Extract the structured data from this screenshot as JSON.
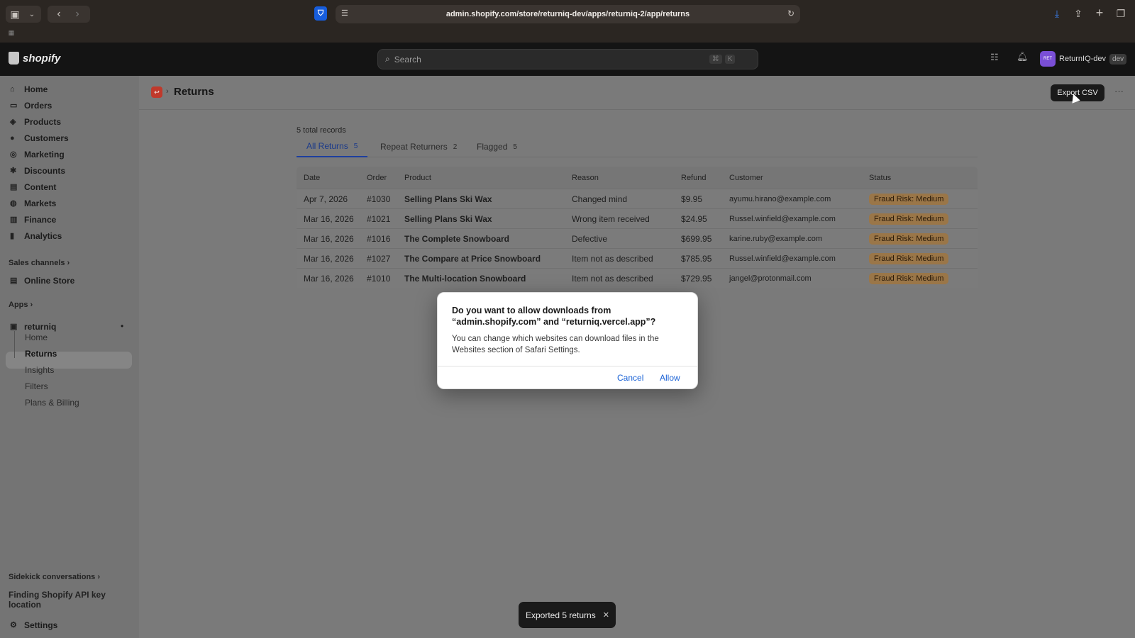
{
  "browser": {
    "url": "admin.shopify.com/store/returniq-dev/apps/returniq-2/app/returns"
  },
  "topbar": {
    "logo_text": "shopify",
    "search_placeholder": "Search",
    "shortcut_cmd": "⌘",
    "shortcut_key": "K",
    "store_avatar_text": "RET",
    "store_name": "ReturnIQ-dev",
    "store_tag": "dev"
  },
  "sidebar": {
    "items": [
      {
        "label": "Home",
        "icon": "home-icon"
      },
      {
        "label": "Orders",
        "icon": "orders-icon"
      },
      {
        "label": "Products",
        "icon": "tag-icon"
      },
      {
        "label": "Customers",
        "icon": "person-icon"
      },
      {
        "label": "Marketing",
        "icon": "target-icon"
      },
      {
        "label": "Discounts",
        "icon": "discount-icon"
      },
      {
        "label": "Content",
        "icon": "content-icon"
      },
      {
        "label": "Markets",
        "icon": "globe-icon"
      },
      {
        "label": "Finance",
        "icon": "bank-icon"
      },
      {
        "label": "Analytics",
        "icon": "chart-icon"
      }
    ],
    "sales_channels_label": "Sales channels",
    "online_store_label": "Online Store",
    "apps_label": "Apps",
    "app_name": "returniq",
    "app_subitems": [
      "Home",
      "Returns",
      "Insights",
      "Filters",
      "Plans & Billing"
    ],
    "sidekick_label": "Sidekick conversations",
    "sidekick_item": "Finding Shopify API key location",
    "settings_label": "Settings"
  },
  "page": {
    "title": "Returns",
    "export_label": "Export CSV",
    "more_label": "···",
    "records_text": "5 total records",
    "tabs": [
      {
        "label": "All Returns",
        "count": "5"
      },
      {
        "label": "Repeat Returners",
        "count": "2"
      },
      {
        "label": "Flagged",
        "count": "5"
      }
    ]
  },
  "table": {
    "headers": [
      "Date",
      "Order",
      "Product",
      "Reason",
      "Refund",
      "Customer",
      "Status"
    ],
    "rows": [
      [
        "Apr 7, 2026",
        "#1030",
        "Selling Plans Ski Wax",
        "Changed mind",
        "$9.95",
        "ayumu.hirano@example.com",
        "Fraud Risk: Medium"
      ],
      [
        "Mar 16, 2026",
        "#1021",
        "Selling Plans Ski Wax",
        "Wrong item received",
        "$24.95",
        "Russel.winfield@example.com",
        "Fraud Risk: Medium"
      ],
      [
        "Mar 16, 2026",
        "#1016",
        "The Complete Snowboard",
        "Defective",
        "$699.95",
        "karine.ruby@example.com",
        "Fraud Risk: Medium"
      ],
      [
        "Mar 16, 2026",
        "#1027",
        "The Compare at Price Snowboard",
        "Item not as described",
        "$785.95",
        "Russel.winfield@example.com",
        "Fraud Risk: Medium"
      ],
      [
        "Mar 16, 2026",
        "#1010",
        "The Multi-location Snowboard",
        "Item not as described",
        "$729.95",
        "jangel@protonmail.com",
        "Fraud Risk: Medium"
      ]
    ]
  },
  "dialog": {
    "title": "Do you want to allow downloads from “admin.shopify.com” and “returniq.vercel.app”?",
    "body": "You can change which websites can download files in the Websites section of Safari Settings.",
    "cancel_label": "Cancel",
    "allow_label": "Allow"
  },
  "toast": {
    "text": "Exported 5 returns",
    "close": "✕"
  },
  "colors": {
    "accent": "#1d3f9e",
    "badge": "#9a7648",
    "app_icon": "#c0392b"
  }
}
